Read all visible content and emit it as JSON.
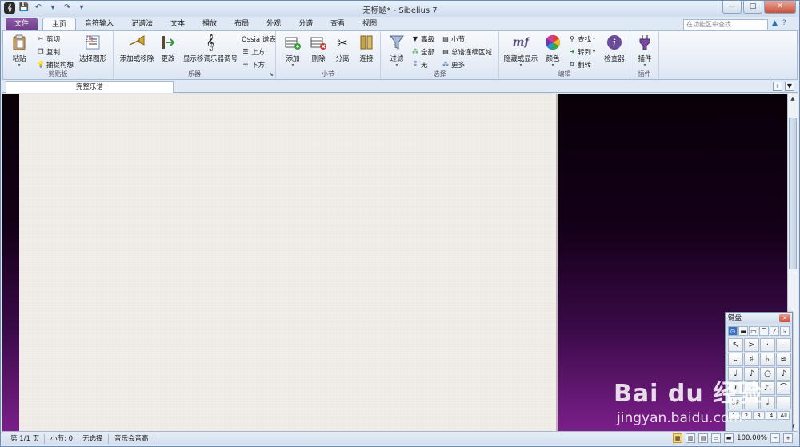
{
  "window": {
    "title": "无标题* - Sibelius 7",
    "controls": {
      "minimize": "—",
      "maximize": "□",
      "close": "✕"
    }
  },
  "qat": {
    "app_glyph": "𝄞",
    "save": "💾",
    "undo": "↶",
    "redo": "↷",
    "more": "▾"
  },
  "tabs": {
    "file": "文件",
    "items": [
      "主页",
      "音符输入",
      "记谱法",
      "文本",
      "播放",
      "布局",
      "外观",
      "分谱",
      "查看",
      "视图"
    ],
    "active_index": 0
  },
  "search": {
    "placeholder": "在功能区中查找"
  },
  "ribbon": {
    "clipboard": {
      "label": "剪贴板",
      "paste": "粘贴",
      "cut": "剪切",
      "copy": "复制",
      "capture_idea": "捕捉构想",
      "select_graphic": "选择图形"
    },
    "instruments": {
      "label": "乐器",
      "add_remove": "添加或移除",
      "change": "更改",
      "show_transposing": "显示移调乐器调号",
      "ossia": "Ossia 谱表",
      "above": "上方",
      "below": "下方"
    },
    "bars": {
      "label": "小节",
      "add": "添加",
      "delete": "删除",
      "split": "分离",
      "join": "连接"
    },
    "select": {
      "label": "选择",
      "filter": "过滤",
      "advanced": "高级",
      "all": "全部",
      "none": "无",
      "bar": "小节",
      "system_passage": "总谱连续区域",
      "more": "更多"
    },
    "edit": {
      "label": "编辑",
      "hide_show": "隐藏或显示",
      "color": "颜色",
      "find": "查找",
      "go_to": "转到",
      "flip": "翻转",
      "inspector": "检查器"
    },
    "plugins": {
      "label": "插件",
      "plugins": "插件"
    }
  },
  "document_tab": {
    "label": "完整乐谱"
  },
  "keypad": {
    "title": "键盘",
    "layouts": [
      "⊙",
      "▬",
      "▭",
      "⌒",
      "⁄",
      "♭"
    ],
    "keys": [
      "↖",
      ">",
      "·",
      "–",
      "𝅝",
      "♯",
      "♭",
      "≋",
      "♩",
      "♪",
      "○",
      "♪",
      "𝄽",
      "𝄾",
      "♪.",
      "⌒",
      "♭♯",
      "·",
      "𝅗𝅥",
      ""
    ],
    "numbers": [
      "1",
      "2",
      "3",
      "4",
      "All"
    ]
  },
  "statusbar": {
    "page": "第 1/1 页",
    "bar": "小节: 0",
    "selection": "无选择",
    "pitch": "音乐会音高",
    "zoom": "100.00%",
    "zoom_out": "−",
    "zoom_in": "+"
  },
  "watermark": {
    "logo": "Bai du 经验",
    "url": "jingyan.baidu.com"
  },
  "colors": {
    "file_tab": "#6a3b87",
    "workspace_bottom": "#7b1f8a",
    "paper": "#f1eee9"
  }
}
